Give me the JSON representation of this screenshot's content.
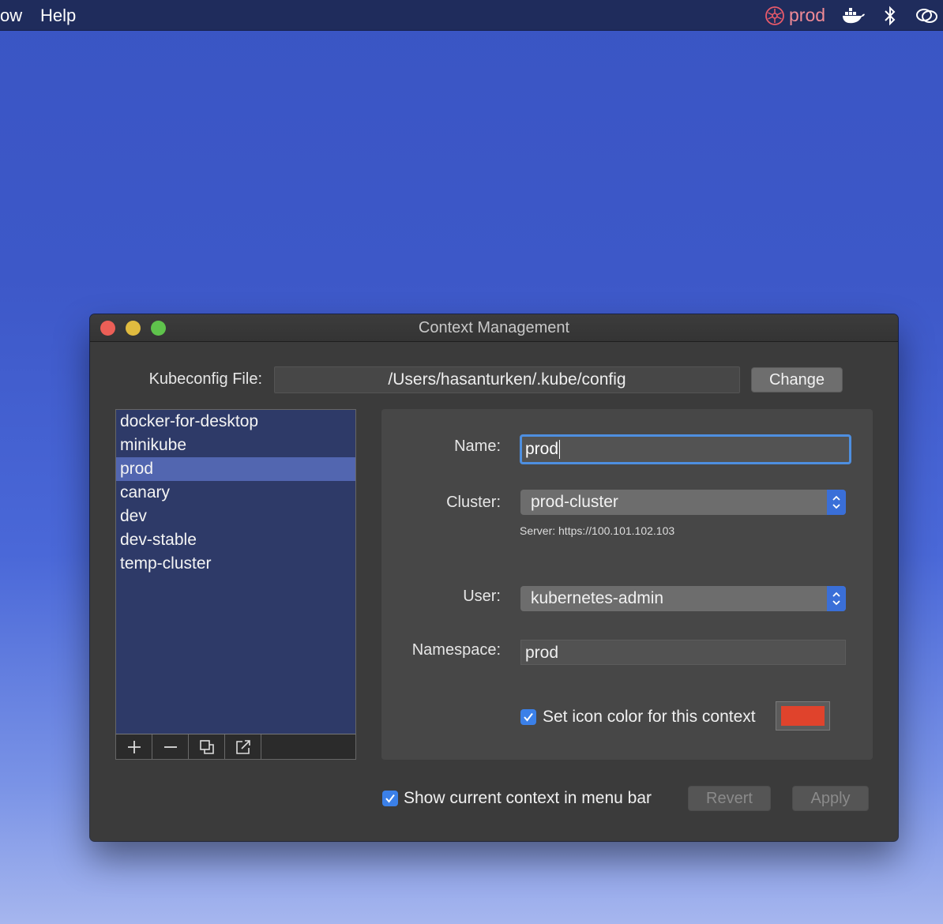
{
  "menubar": {
    "items": [
      "ow",
      "Help"
    ],
    "status_item": {
      "label": "prod",
      "icon": "kubernetes-icon",
      "color": "#f08a96"
    },
    "tray_icons": [
      "docker-icon",
      "bluetooth-icon",
      "rings-icon"
    ]
  },
  "window": {
    "title": "Context Management",
    "kubeconfig": {
      "label": "Kubeconfig File:",
      "path": "/Users/hasanturken/.kube/config",
      "change_button": "Change"
    },
    "contexts": [
      "docker-for-desktop",
      "minikube",
      "prod",
      "canary",
      "dev",
      "dev-stable",
      "temp-cluster"
    ],
    "selected_context": "prod",
    "list_toolbar": [
      "plus-icon",
      "minus-icon",
      "duplicate-icon",
      "export-icon"
    ],
    "detail": {
      "name_label": "Name:",
      "name_value": "prod",
      "cluster_label": "Cluster:",
      "cluster_value": "prod-cluster",
      "server_text": "Server: https://100.101.102.103",
      "user_label": "User:",
      "user_value": "kubernetes-admin",
      "namespace_label": "Namespace:",
      "namespace_value": "prod",
      "icon_color_checkbox": {
        "label": "Set icon color for this context",
        "checked": true
      },
      "icon_color": "#e0432c"
    },
    "footer": {
      "show_context_checkbox": {
        "label": "Show current context in menu bar",
        "checked": true
      },
      "revert_button": "Revert",
      "apply_button": "Apply"
    }
  }
}
